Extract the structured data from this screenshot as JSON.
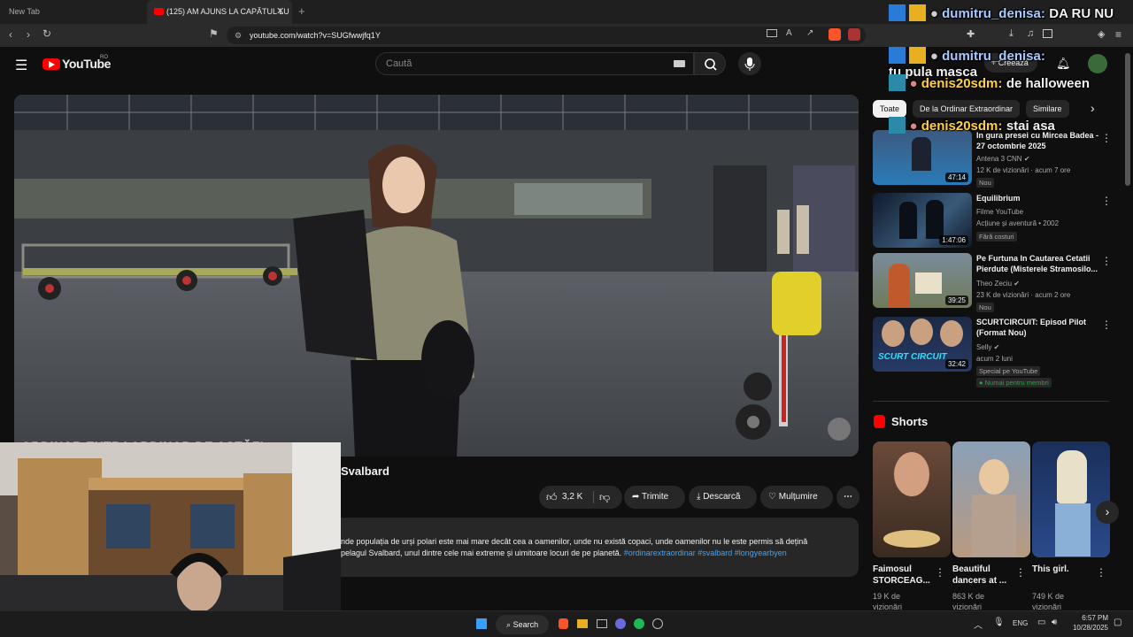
{
  "browser": {
    "tabs": [
      {
        "label": "New Tab"
      },
      {
        "label": "(125) AM AJUNS LA CAPĂTUL LU"
      }
    ],
    "url": "youtube.com/watch?v=SUGfwwjfq1Y"
  },
  "youtube": {
    "logo_text": "YouTube",
    "region": "RO",
    "search_placeholder": "Caută",
    "create_label": "Creează"
  },
  "video": {
    "overlay_text": "ORDINAR EXTRAORDINAR DE ASTĂZI",
    "title_fragment": "Svalbard",
    "likes": "3,2 K",
    "share_label": "Trimite",
    "download_label": "Descarcă",
    "thanks_label": "Mulțumire",
    "description_line1": "nde populația de urși polari este mai mare decât cea a oamenilor, unde nu există copaci, unde oamenilor nu le este permis să dețină",
    "description_line2": "pelagul Svalbard, unul dintre cele mai extreme și uimitoare locuri de pe planetă.",
    "hashtags": "#ordinarextraordinar #svalbard #longyearbyen"
  },
  "chips": [
    "Toate",
    "De la Ordinar Extraordinar",
    "Similare"
  ],
  "recommendations": [
    {
      "title": "In gura presei cu Mircea Badea - 27 octombrie 2025",
      "channel": "Antena 3 CNN",
      "meta": "12 K de vizionări · acum 7 ore",
      "badge": "Nou",
      "duration": "47:14"
    },
    {
      "title": "Equilibrium",
      "channel": "Filme YouTube",
      "meta": "Acțiune și aventură • 2002",
      "badge": "Fără costuri",
      "duration": "1:47:06"
    },
    {
      "title": "Pe Furtuna In Cautarea Cetatii Pierdute (Misterele Stramosilo...",
      "channel": "Theo Zeciu",
      "meta": "23 K de vizionări · acum 2 ore",
      "badge": "Nou",
      "duration": "39:25"
    },
    {
      "title": "SCURTCIRCUIT: Episod Pilot (Format Nou)",
      "channel": "Selly",
      "meta": "acum 2 luni",
      "badge": "Special pe YouTube",
      "badge2": "Numai pentru membri",
      "duration": "32:42",
      "thumb_text": "SCURT CIRCUIT"
    }
  ],
  "shorts": {
    "heading": "Shorts",
    "items": [
      {
        "title": "Faimosul STORCEAG...",
        "views": "19 K de vizionări"
      },
      {
        "title": "Beautiful dancers at ...",
        "views": "863 K de vizionări"
      },
      {
        "title": "This girl.",
        "views": "749 K de vizionări"
      }
    ]
  },
  "chat": [
    {
      "user": "dumitru_denisa:",
      "text": "DA RU NU"
    },
    {
      "user": "dumitru_denisa:",
      "text": "tu pula masca"
    },
    {
      "user": "denis20sdm:",
      "text": "de halloween"
    },
    {
      "user": "denis20sdm:",
      "text": "stai asa"
    }
  ],
  "taskbar": {
    "search_label": "Search",
    "lang": "ENG",
    "time": "6:57 PM",
    "date": "10/28/2025"
  },
  "colors": {
    "youtube_red": "#ff0000",
    "link_blue": "#3ea6ff",
    "chat_blue": "#a8c8ff",
    "chat_orange": "#ffd23c"
  }
}
